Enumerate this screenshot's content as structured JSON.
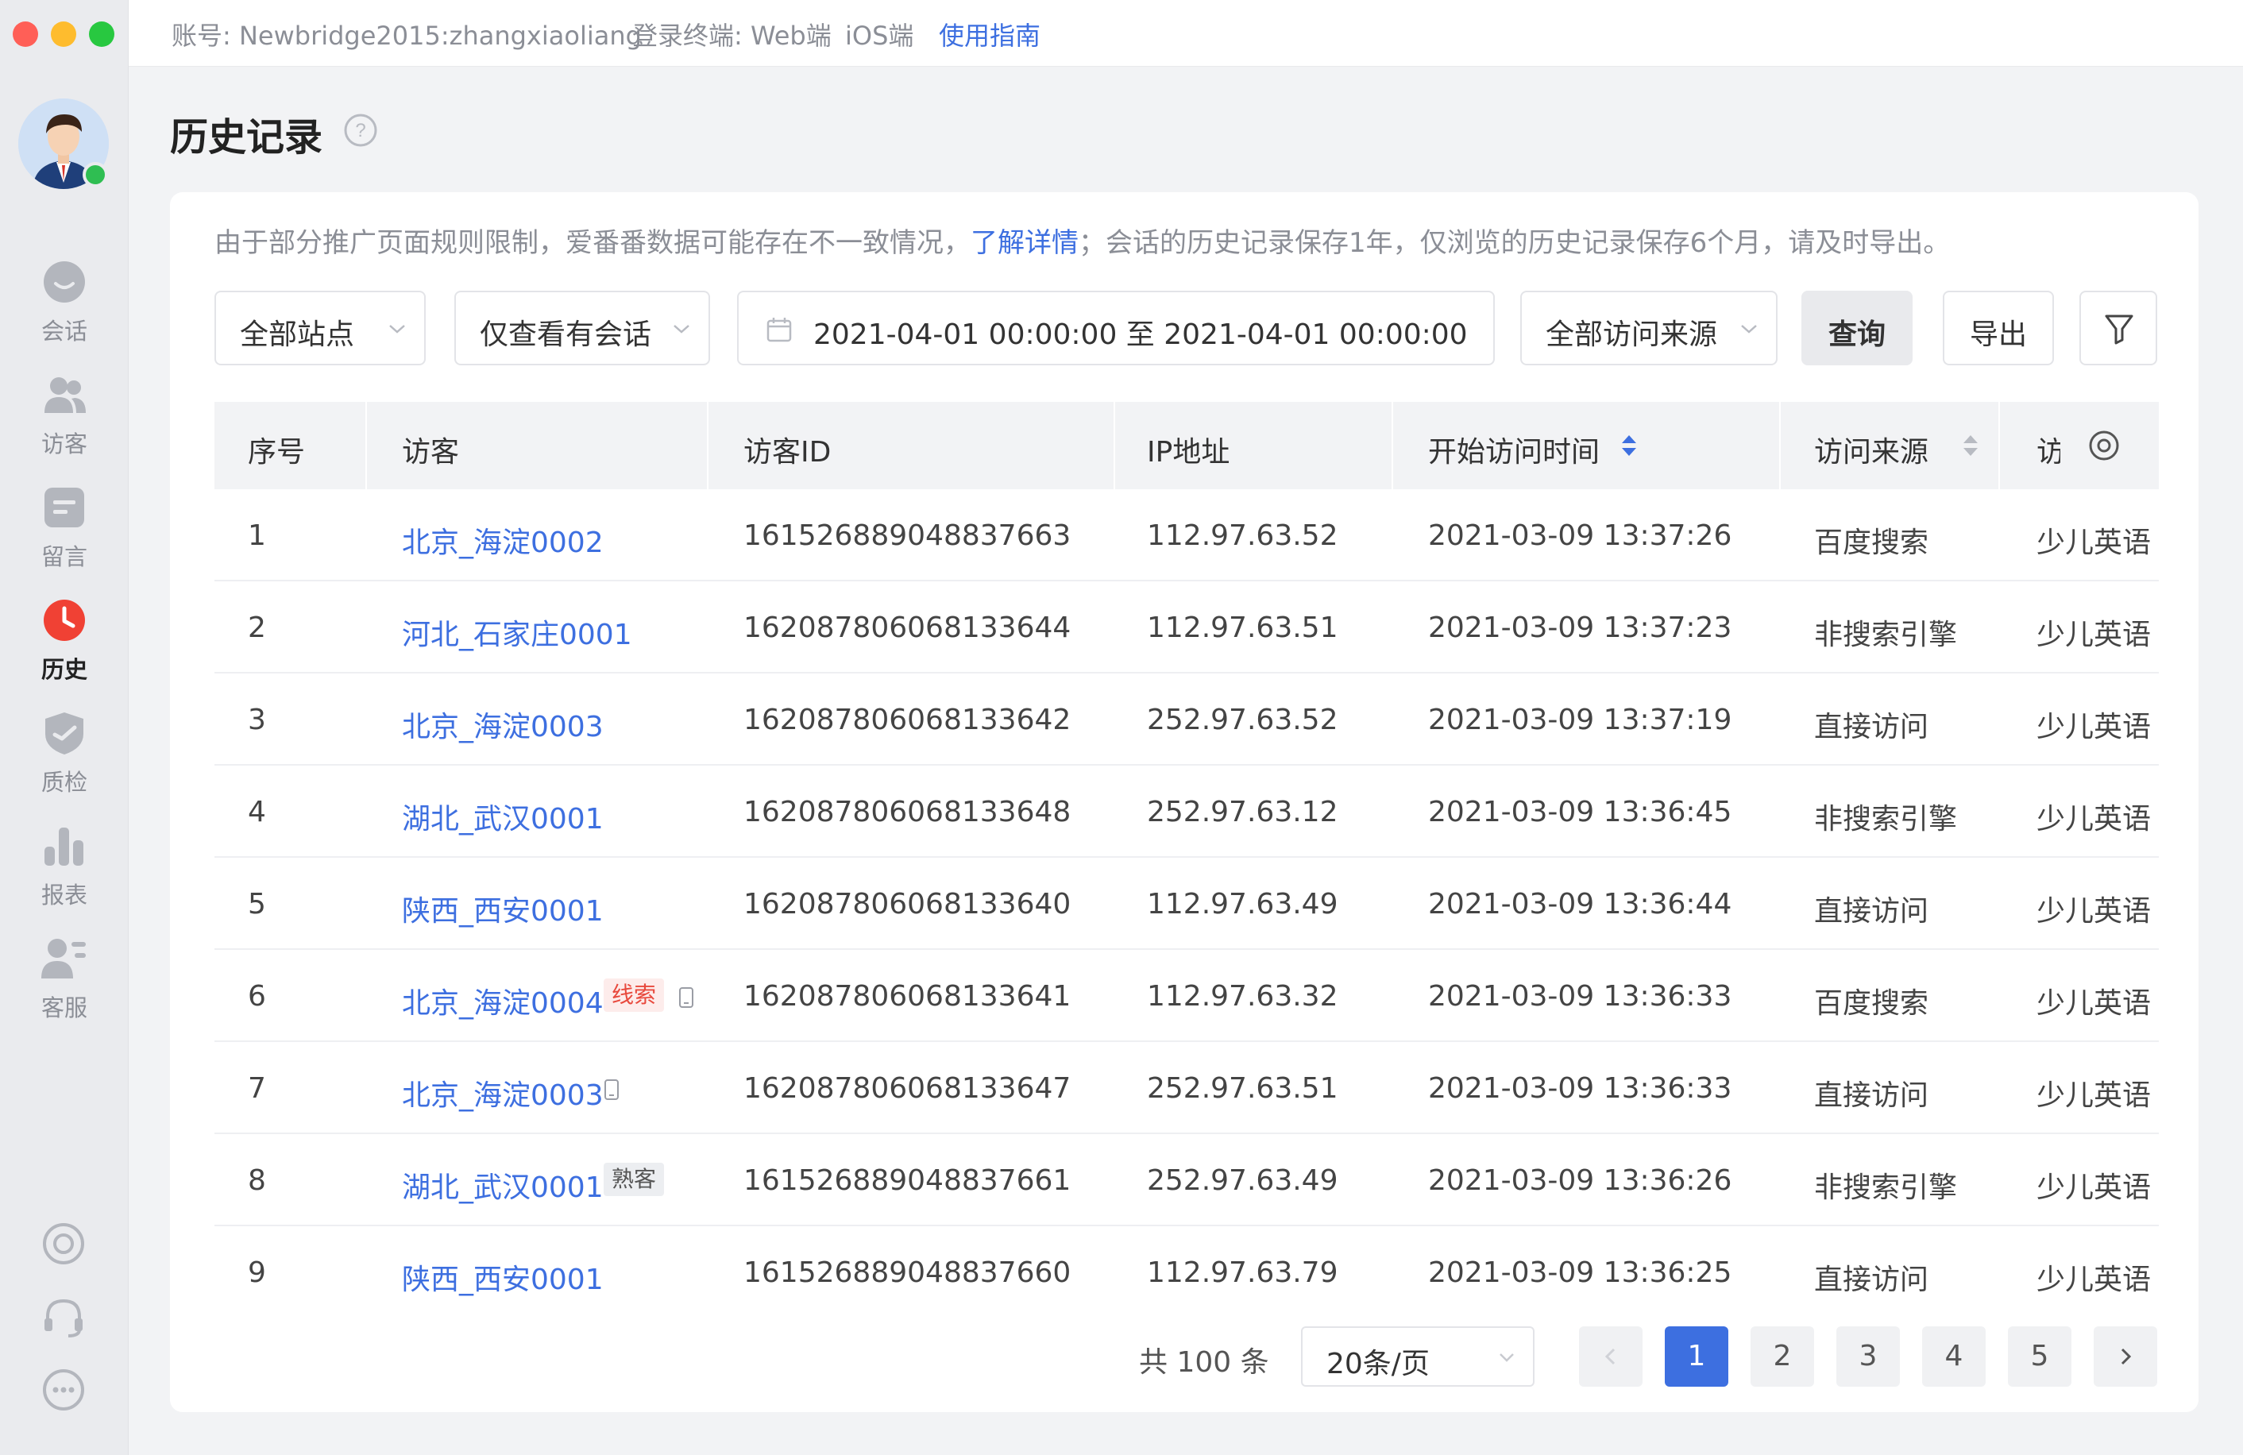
{
  "topbar": {
    "account": "账号: Newbridge2015:zhangxiaoliang",
    "terminals_label": "登录终端: Web端",
    "ios": "iOS端",
    "guide_link": "使用指南"
  },
  "sidebar": {
    "items": [
      {
        "label": "会话",
        "icon": "chat-icon"
      },
      {
        "label": "访客",
        "icon": "visitors-icon"
      },
      {
        "label": "留言",
        "icon": "message-icon"
      },
      {
        "label": "历史",
        "icon": "history-clock-icon"
      },
      {
        "label": "质检",
        "icon": "quality-check-icon"
      },
      {
        "label": "报表",
        "icon": "report-chart-icon"
      },
      {
        "label": "客服",
        "icon": "agent-icon"
      }
    ],
    "active_item": "历史"
  },
  "page": {
    "title": "历史记录",
    "notice_before": "由于部分推广页面规则限制，爱番番数据可能存在不一致情况，",
    "notice_link": "了解详情",
    "notice_after": "；会话的历史记录保存1年，仅浏览的历史记录保存6个月，请及时导出。"
  },
  "filters": {
    "site": "全部站点",
    "session_filter": "仅查看有会话",
    "date_range": "2021-04-01 00:00:00 至 2021-04-01 00:00:00",
    "source": "全部访问来源",
    "query_button": "查询",
    "export_button": "导出"
  },
  "table": {
    "columns": [
      "序号",
      "访客",
      "访客ID",
      "IP地址",
      "开始访问时间",
      "访问来源",
      "访"
    ],
    "rows": [
      {
        "no": "1",
        "visitor": "北京_海淀0002",
        "id": "161526889048837663",
        "ip": "112.97.63.52",
        "time": "2021-03-09 13:37:26",
        "source": "百度搜索",
        "page": "少儿英语"
      },
      {
        "no": "2",
        "visitor": "河北_石家庄0001",
        "id": "162087806068133644",
        "ip": "112.97.63.51",
        "time": "2021-03-09 13:37:23",
        "source": "非搜索引擎",
        "page": "少儿英语"
      },
      {
        "no": "3",
        "visitor": "北京_海淀0003",
        "id": "162087806068133642",
        "ip": "252.97.63.52",
        "time": "2021-03-09 13:37:19",
        "source": "直接访问",
        "page": "少儿英语"
      },
      {
        "no": "4",
        "visitor": "湖北_武汉0001",
        "id": "162087806068133648",
        "ip": "252.97.63.12",
        "time": "2021-03-09 13:36:45",
        "source": "非搜索引擎",
        "page": "少儿英语"
      },
      {
        "no": "5",
        "visitor": "陕西_西安0001",
        "id": "162087806068133640",
        "ip": "112.97.63.49",
        "time": "2021-03-09 13:36:44",
        "source": "直接访问",
        "page": "少儿英语"
      },
      {
        "no": "6",
        "visitor": "北京_海淀0004",
        "id": "162087806068133641",
        "ip": "112.97.63.32",
        "time": "2021-03-09 13:36:33",
        "source": "百度搜索",
        "page": "少儿英语",
        "tag": "线索",
        "tag_type": "lead",
        "device": true
      },
      {
        "no": "7",
        "visitor": "北京_海淀0003",
        "id": "162087806068133647",
        "ip": "252.97.63.51",
        "time": "2021-03-09 13:36:33",
        "source": "直接访问",
        "page": "少儿英语",
        "device": true
      },
      {
        "no": "8",
        "visitor": "湖北_武汉0001",
        "id": "161526889048837661",
        "ip": "252.97.63.49",
        "time": "2021-03-09 13:36:26",
        "source": "非搜索引擎",
        "page": "少儿英语",
        "tag": "熟客",
        "tag_type": "returning"
      },
      {
        "no": "9",
        "visitor": "陕西_西安0001",
        "id": "161526889048837660",
        "ip": "112.97.63.79",
        "time": "2021-03-09 13:36:25",
        "source": "直接访问",
        "page": "少儿英语"
      }
    ]
  },
  "pagination": {
    "total": "共 100 条",
    "page_size": "20条/页",
    "pages": [
      "1",
      "2",
      "3",
      "4",
      "5"
    ],
    "current": "1"
  },
  "colors": {
    "accent": "#3d6fe0",
    "active_nav_icon": "#f04134",
    "lead_tag": "#e8493d"
  }
}
